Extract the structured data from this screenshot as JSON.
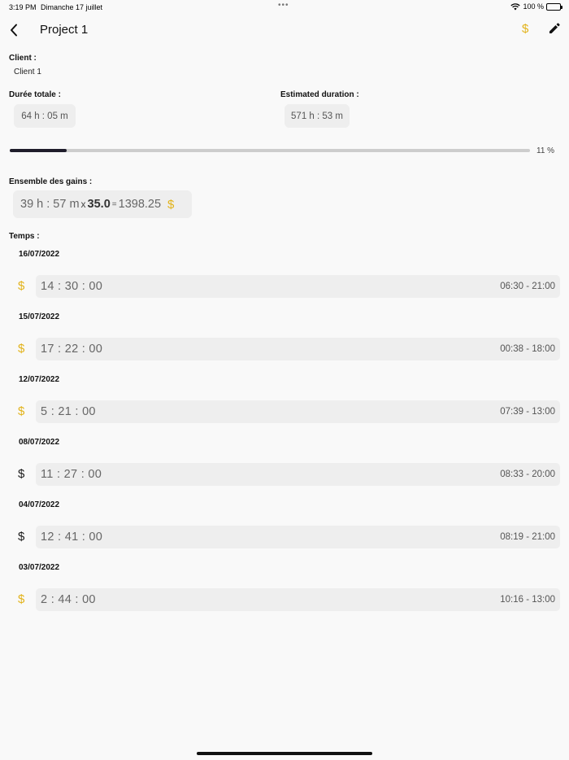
{
  "status": {
    "time": "3:19 PM",
    "date": "Dimanche 17 juillet",
    "dots": "•••",
    "battery": "100 %"
  },
  "nav": {
    "title": "Project 1",
    "dollar": "$"
  },
  "client": {
    "label": "Client :",
    "value": "Client 1"
  },
  "durations": {
    "total_label": "Durée totale :",
    "total_value": "64 h : 05 m",
    "estimated_label": "Estimated duration :",
    "estimated_value": "571 h : 53 m"
  },
  "progress": {
    "value": 0.11,
    "text": "11 %"
  },
  "gains": {
    "label": "Ensemble des gains :",
    "time": "39 h : 57 m",
    "times_sign": "x",
    "rate": "35.0",
    "equals": "=",
    "total": "1398.25",
    "currency": "$"
  },
  "times": {
    "label": "Temps :",
    "entries": [
      {
        "date": "16/07/2022",
        "duration": "14 : 30 : 00",
        "range": "06:30 - 21:00",
        "paid": true
      },
      {
        "date": "15/07/2022",
        "duration": "17 : 22 : 00",
        "range": "00:38 - 18:00",
        "paid": true
      },
      {
        "date": "12/07/2022",
        "duration": "5 : 21 : 00",
        "range": "07:39 - 13:00",
        "paid": true
      },
      {
        "date": "08/07/2022",
        "duration": "11 : 27 : 00",
        "range": "08:33 - 20:00",
        "paid": false
      },
      {
        "date": "04/07/2022",
        "duration": "12 : 41 : 00",
        "range": "08:19 - 21:00",
        "paid": false
      },
      {
        "date": "03/07/2022",
        "duration": "2 : 44 : 00",
        "range": "10:16 - 13:00",
        "paid": true
      }
    ],
    "currency": "$"
  },
  "colors": {
    "paid": "#e2b31b",
    "unpaid": "#1a1a1a",
    "progress": "#1f1d2b"
  },
  "icons": {
    "back": "chevron-left-icon",
    "edit": "pencil-icon",
    "wifi": "wifi-icon",
    "battery": "battery-icon"
  }
}
